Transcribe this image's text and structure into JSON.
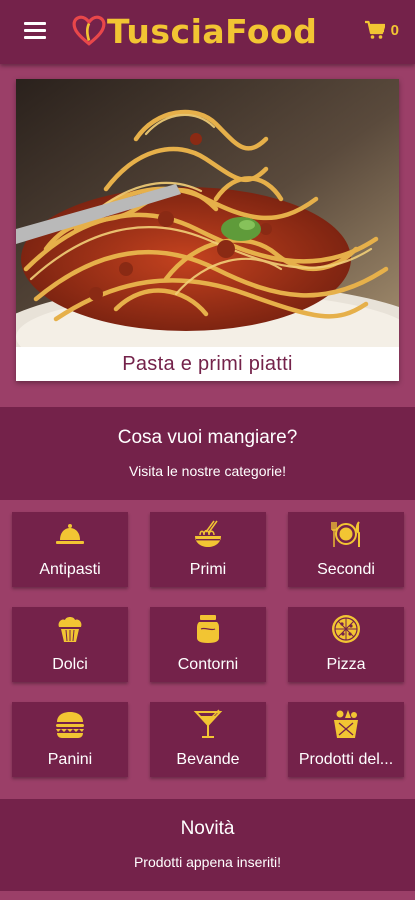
{
  "header": {
    "brand": "TusciaFood",
    "cart_count": "0"
  },
  "hero": {
    "caption": "Pasta e primi piatti"
  },
  "categories_band": {
    "title": "Cosa vuoi mangiare?",
    "subtitle": "Visita le nostre categorie!"
  },
  "categories": [
    {
      "label": "Antipasti",
      "icon": "cloche-icon"
    },
    {
      "label": "Primi",
      "icon": "pasta-bowl-icon"
    },
    {
      "label": "Secondi",
      "icon": "plate-cutlery-icon"
    },
    {
      "label": "Dolci",
      "icon": "cupcake-icon"
    },
    {
      "label": "Contorni",
      "icon": "jar-icon"
    },
    {
      "label": "Pizza",
      "icon": "pizza-icon"
    },
    {
      "label": "Panini",
      "icon": "burger-icon"
    },
    {
      "label": "Bevande",
      "icon": "cocktail-icon"
    },
    {
      "label": "Prodotti del...",
      "icon": "basket-icon"
    }
  ],
  "news_band": {
    "title": "Novità",
    "subtitle": "Prodotti appena inseriti!"
  },
  "colors": {
    "background": "#9b3f68",
    "bar": "#74224a",
    "accent": "#f2c533"
  }
}
